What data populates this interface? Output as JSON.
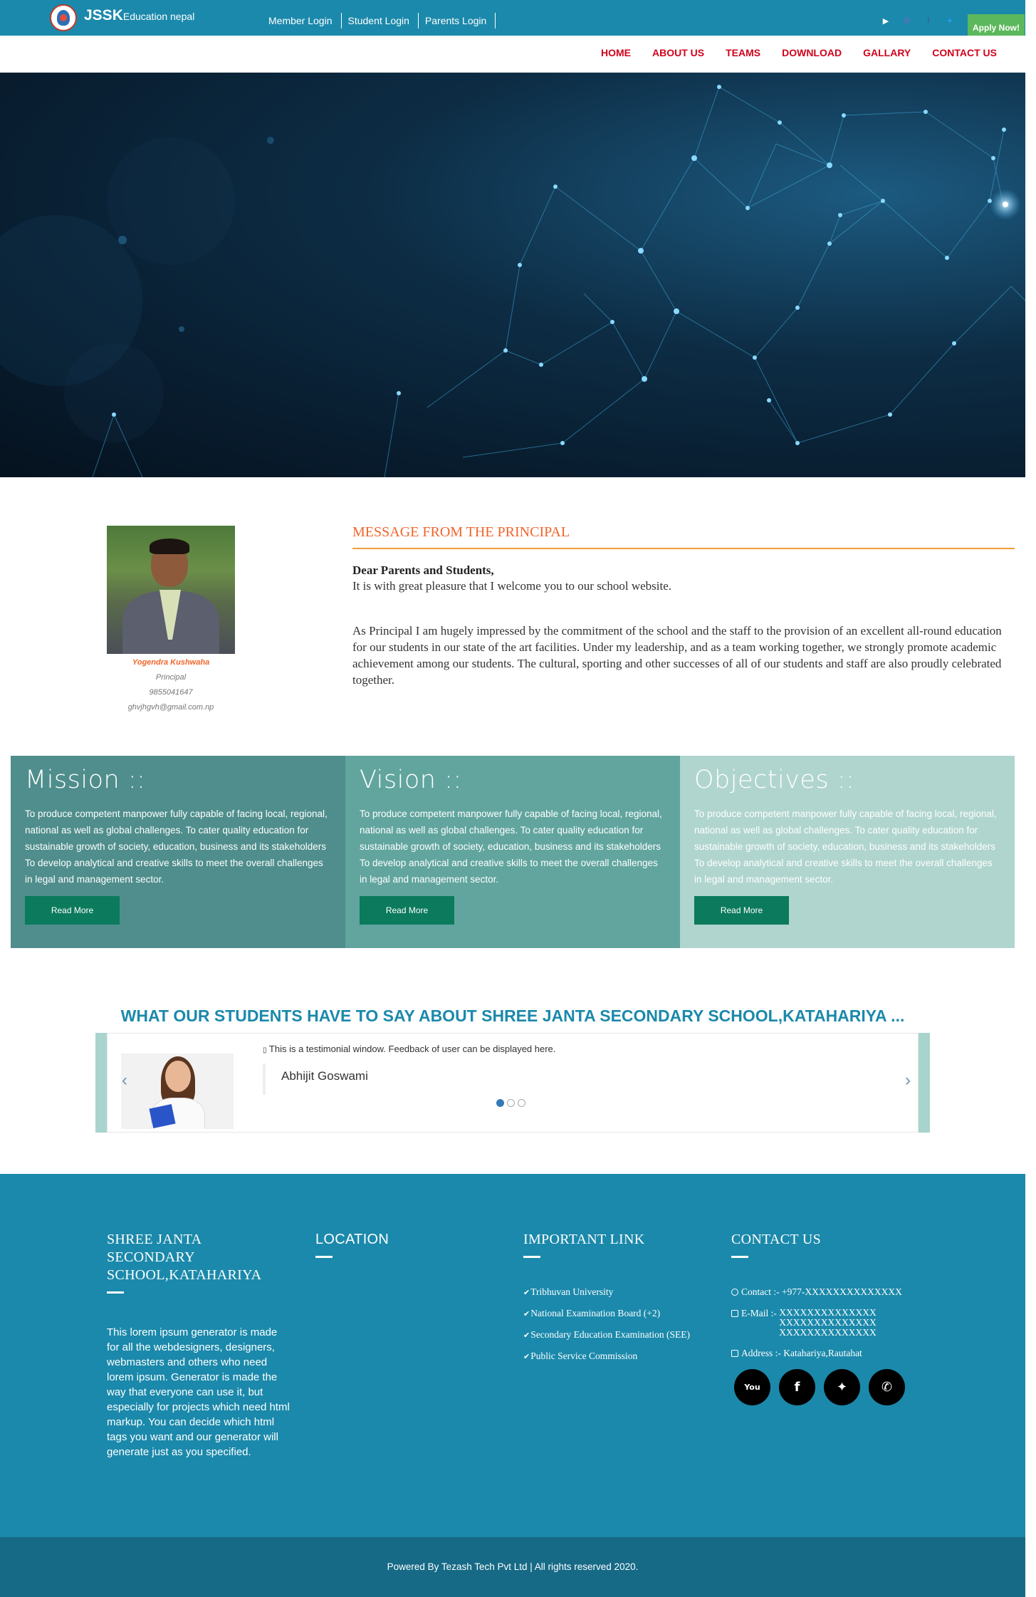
{
  "topbar": {
    "brand_main": "JSSK",
    "brand_sub": "Education nepal",
    "logins": [
      "Member Login",
      "Student Login",
      "Parents Login"
    ],
    "social": [
      "youtube-icon",
      "viber-icon",
      "facebook-icon",
      "twitter-icon"
    ],
    "apply_label": "Apply Now!"
  },
  "nav": {
    "items": [
      "HOME",
      "ABOUT US",
      "TEAMS",
      "DOWNLOAD",
      "GALLARY",
      "CONTACT US"
    ]
  },
  "principal": {
    "name": "Yogendra Kushwaha",
    "role": "Principal",
    "phone": "9855041647",
    "email": "ghvjhgvh@gmail.com.np"
  },
  "message": {
    "title": "MESSAGE FROM THE PRINCIPAL",
    "greeting": "Dear Parents and Students,",
    "line1": "It is with great pleasure that I welcome you to our school website.",
    "line2": "As Principal I am hugely impressed by the commitment of the school and the staff to the provision of an excellent all-round education for our students in our state of the art facilities. Under my leadership, and as a team working together, we strongly promote academic achievement among our students. The cultural, sporting and other successes of all of our students and staff are also proudly celebrated together."
  },
  "mvo": [
    {
      "title": "Mission ::",
      "text": "To produce competent manpower fully capable of facing local, regional, national as well as global challenges. To cater quality education for sustainable growth of society, education, business and its stakeholders To develop analytical and creative skills to meet the overall challenges in legal and management sector.",
      "button": "Read More"
    },
    {
      "title": "Vision ::",
      "text": "To produce competent manpower fully capable of facing local, regional, national as well as global challenges. To cater quality education for sustainable growth of society, education, business and its stakeholders To develop analytical and creative skills to meet the overall challenges in legal and management sector.",
      "button": "Read More"
    },
    {
      "title": "Objectives ::",
      "text": "To produce competent manpower fully capable of facing local, regional, national as well as global challenges. To cater quality education for sustainable growth of society, education, business and its stakeholders To develop analytical and creative skills to meet the overall challenges in legal and management sector.",
      "button": "Read More"
    }
  ],
  "testimonials": {
    "title": "WHAT OUR STUDENTS HAVE TO SAY ABOUT SHREE JANTA SECONDARY SCHOOL,KATAHARIYA ...",
    "quote": "This is a testimonial window. Feedback of user can be displayed here.",
    "name": "Abhijit Goswami",
    "prev": "‹",
    "next": "›",
    "active_slide": 1,
    "slides_count": 3
  },
  "footer": {
    "school_title": "SHREE JANTA SECONDARY SCHOOL,KATAHARIYA",
    "about": "This lorem ipsum generator is made for all the webdesigners, designers, webmasters and others who need lorem ipsum. Generator is made the way that everyone can use it, but especially for projects which need html markup. You can decide which html tags you want and our generator will generate just as you specified.",
    "location_title": "LOCATION",
    "links_title": "IMPORTANT LINK",
    "links": [
      "Tribhuvan University",
      "National Examination Board (+2)",
      "Secondary Education Examination (SEE)",
      "Public Service Commission"
    ],
    "contact_title": "CONTACT US",
    "contact_phone": "Contact :- +977-XXXXXXXXXXXXXX",
    "email_label": "E-Mail :-",
    "emails": [
      "XXXXXXXXXXXXXX",
      "XXXXXXXXXXXXXX",
      "XXXXXXXXXXXXXX"
    ],
    "address": "Address :- Katahariya,Rautahat",
    "social": [
      "youtube-icon",
      "facebook-icon",
      "twitter-icon",
      "whatsapp-icon"
    ]
  },
  "copyright": "Powered By Tezash Tech Pvt Ltd | All rights reserved 2020."
}
